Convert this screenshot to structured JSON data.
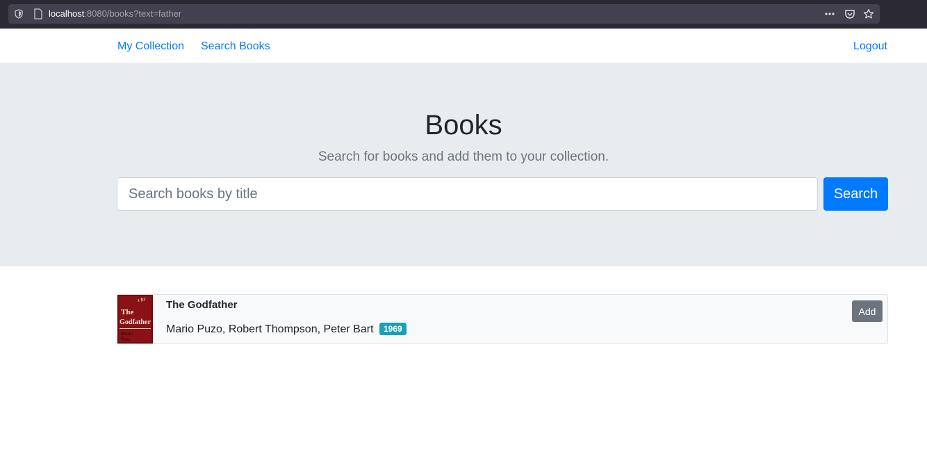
{
  "browser": {
    "url_host": "localhost",
    "url_rest": ":8080/books?text=father",
    "icons": [
      "shield-icon",
      "page-icon",
      "more-icon",
      "pocket-icon",
      "bookmark-star-icon"
    ]
  },
  "navbar": {
    "links": [
      {
        "label": "My Collection"
      },
      {
        "label": "Search Books"
      }
    ],
    "logout_label": "Logout"
  },
  "hero": {
    "title": "Books",
    "lead": "Search for books and add them to your collection.",
    "search_placeholder": "Search books by title",
    "search_value": "",
    "search_button": "Search"
  },
  "results": [
    {
      "title": "The Godfather",
      "authors": "Mario Puzo, Robert Thompson, Peter Bart",
      "year": "1969",
      "add_label": "Add",
      "cover": {
        "title_line1": "The",
        "title_line2": "Godfather",
        "author_line1": "Mario",
        "author_line2": "Puzo"
      }
    }
  ],
  "colors": {
    "primary": "#007bff",
    "secondary": "#6c757d",
    "info_badge": "#17a2b8",
    "jumbotron_bg": "#e9ecef"
  }
}
